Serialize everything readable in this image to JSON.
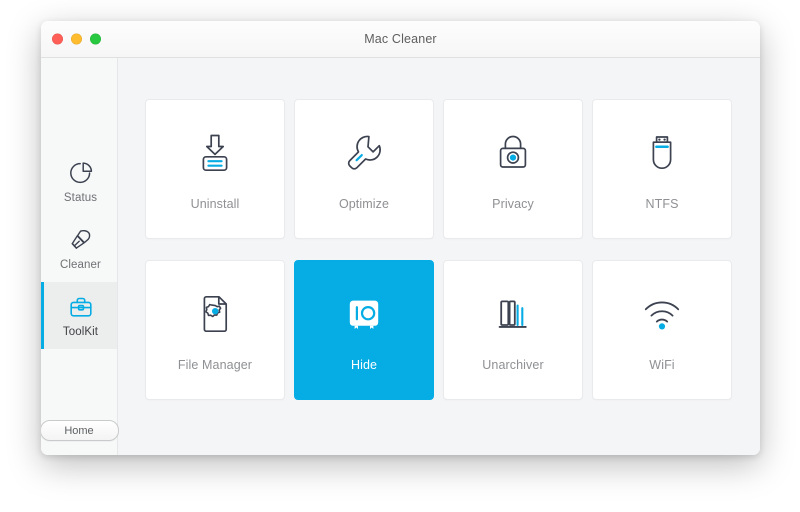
{
  "window": {
    "title": "Mac Cleaner",
    "traffic_lights": [
      {
        "name": "close",
        "color": "#ff5f57"
      },
      {
        "name": "minimize",
        "color": "#febc2e"
      },
      {
        "name": "maximize",
        "color": "#28c840"
      }
    ]
  },
  "theme": {
    "accent": "#06ace4",
    "icon_stroke": "#3c4250",
    "label_text": "#8e9093",
    "sidebar_bg": "#f7f8f8",
    "content_bg": "#f4f5f7",
    "card_bg": "#ffffff"
  },
  "sidebar": {
    "items": [
      {
        "label": "Status",
        "icon": "pie-chart-icon",
        "active": false
      },
      {
        "label": "Cleaner",
        "icon": "brush-icon",
        "active": false
      },
      {
        "label": "ToolKit",
        "icon": "toolbox-icon",
        "active": true
      }
    ],
    "home_button": {
      "label": "Home"
    }
  },
  "content": {
    "tools": [
      {
        "label": "Uninstall",
        "icon": "uninstall-icon",
        "selected": false
      },
      {
        "label": "Optimize",
        "icon": "wrench-icon",
        "selected": false
      },
      {
        "label": "Privacy",
        "icon": "padlock-icon",
        "selected": false
      },
      {
        "label": "NTFS",
        "icon": "usb-drive-icon",
        "selected": false
      },
      {
        "label": "File Manager",
        "icon": "file-gear-icon",
        "selected": false
      },
      {
        "label": "Hide",
        "icon": "safe-vault-icon",
        "selected": true
      },
      {
        "label": "Unarchiver",
        "icon": "archive-bars-icon",
        "selected": false
      },
      {
        "label": "WiFi",
        "icon": "wifi-icon",
        "selected": false
      }
    ]
  }
}
